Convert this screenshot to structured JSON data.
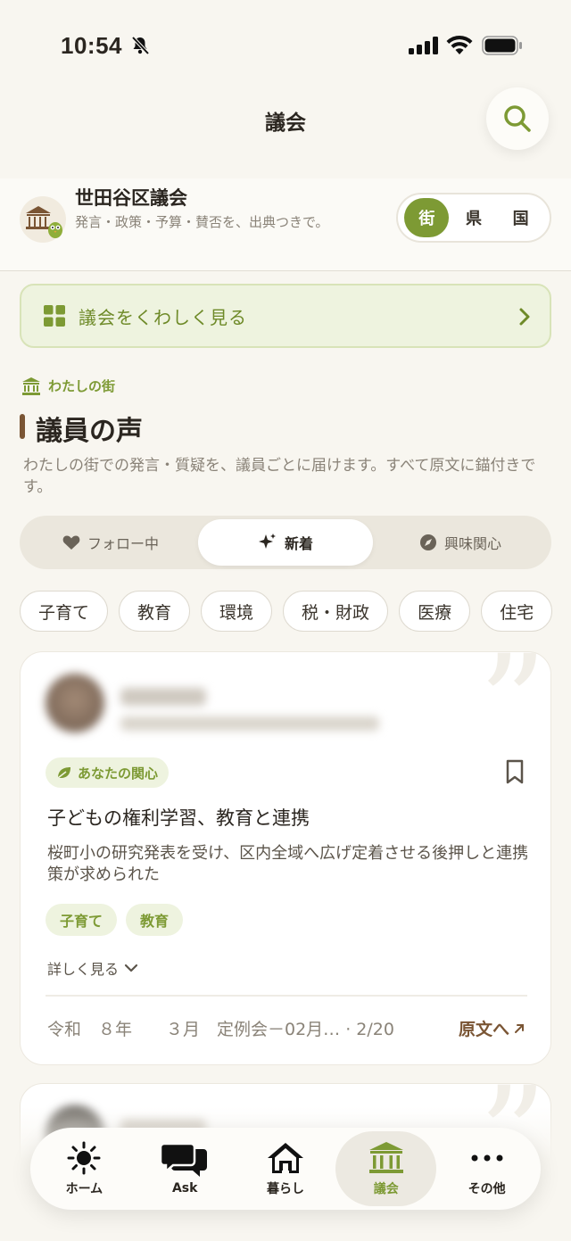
{
  "status_bar": {
    "time": "10:54"
  },
  "header": {
    "title": "議会"
  },
  "assembly": {
    "name": "世田谷区議会",
    "description": "発言・政策・予算・賛否を、出典つきで。",
    "levels": [
      "街",
      "県",
      "国"
    ],
    "active_level": "街"
  },
  "banner": {
    "label": "議会をくわしく見る"
  },
  "section": {
    "kicker": "わたしの街",
    "title": "議員の声",
    "description": "わたしの街での発言・質疑を、議員ごとに届けます。すべて原文に錨付きです。"
  },
  "feed_tabs": [
    {
      "label": "フォロー中",
      "icon": "heart-icon"
    },
    {
      "label": "新着",
      "icon": "sparkle-icon"
    },
    {
      "label": "興味関心",
      "icon": "compass-icon"
    }
  ],
  "active_feed_tab": "新着",
  "topic_chips": [
    "子育て",
    "教育",
    "環境",
    "税・財政",
    "医療",
    "住宅"
  ],
  "card": {
    "badge": "あなたの関心",
    "title": "子どもの権利学習、教育と連携",
    "summary": "桜町小の研究発表を受け、区内全域へ広げ定着させる後押しと連携策が求められた",
    "tags": [
      "子育て",
      "教育"
    ],
    "more_label": "詳しく見る",
    "footer": "令和　８年　　３月　定例会－02月… · 2/20",
    "source_label": "原文へ"
  },
  "tab_bar": [
    {
      "label": "ホーム",
      "icon": "sun-icon"
    },
    {
      "label": "Ask",
      "icon": "chat-bubbles-icon"
    },
    {
      "label": "暮らし",
      "icon": "house-icon"
    },
    {
      "label": "議会",
      "icon": "assembly-building-icon"
    },
    {
      "label": "その他",
      "icon": "more-dots-icon"
    }
  ],
  "active_tab": "議会",
  "colors": {
    "accent": "#7d9a34",
    "brown": "#7a5534",
    "background": "#f8f6f0"
  }
}
